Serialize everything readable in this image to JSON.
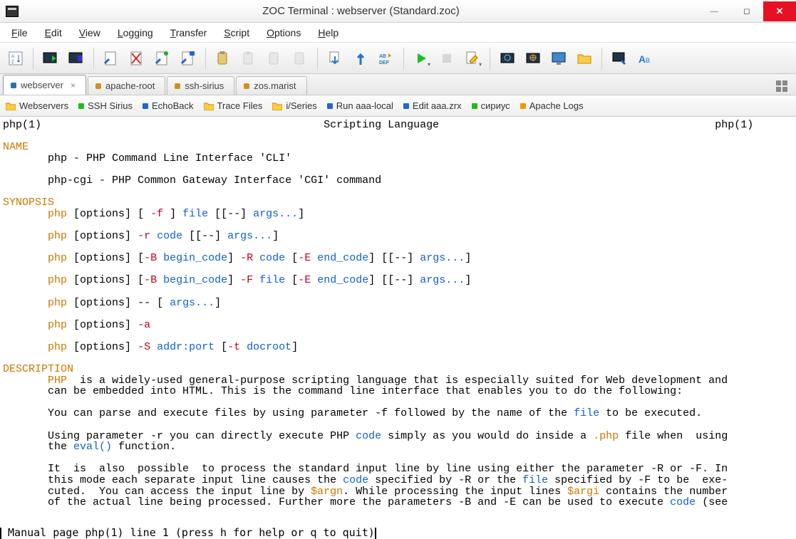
{
  "window": {
    "title": "ZOC Terminal : webserver (Standard.zoc)"
  },
  "menu": {
    "file": "File",
    "edit": "Edit",
    "view": "View",
    "logging": "Logging",
    "transfer": "Transfer",
    "script": "Script",
    "options": "Options",
    "help": "Help"
  },
  "toolbar_icons": [
    "hostdir",
    "quick1",
    "quick2",
    "send1",
    "send-del",
    "send2",
    "send3",
    "clip-copy",
    "clip-paste",
    "clip-gray1",
    "clip-gray2",
    "download",
    "upload",
    "abc-def",
    "play",
    "stop",
    "edit-script",
    "screen1",
    "screen2",
    "monitor",
    "folder",
    "screen-tool",
    "font"
  ],
  "tabs": [
    {
      "label": "webserver",
      "color": "#2a6db0",
      "active": true,
      "closable": true
    },
    {
      "label": "apache-root",
      "color": "#d09020",
      "active": false,
      "closable": false
    },
    {
      "label": "ssh-sirius",
      "color": "#d09020",
      "active": false,
      "closable": false
    },
    {
      "label": "zos.marist",
      "color": "#d09020",
      "active": false,
      "closable": false
    }
  ],
  "bookmarks": [
    {
      "label": "Webservers",
      "type": "folder"
    },
    {
      "label": "SSH Sirius",
      "type": "green"
    },
    {
      "label": "EchoBack",
      "type": "blue"
    },
    {
      "label": "Trace Files",
      "type": "folder"
    },
    {
      "label": "i/Series",
      "type": "folder"
    },
    {
      "label": "Run aaa-local",
      "type": "blue"
    },
    {
      "label": "Edit aaa.zrx",
      "type": "blue"
    },
    {
      "label": "сириус",
      "type": "green"
    },
    {
      "label": "Apache Logs",
      "type": "orange"
    }
  ],
  "man": {
    "header_left": "php(1)",
    "header_center": "Scripting Language",
    "header_right": "php(1)",
    "sec_name": "NAME",
    "name_l1": "php - PHP Command Line Interface 'CLI'",
    "name_l2": "php-cgi - PHP Common Gateway Interface 'CGI' command",
    "sec_syn": "SYNOPSIS",
    "syn": {
      "php": "php",
      "opts": "[options]",
      "f": "-f",
      "file": "file",
      "dd": "[--]",
      "args": "args...",
      "r": "-r",
      "code": "code",
      "B": "-B",
      "begin": "begin_code",
      "R": "-R",
      "E": "-E",
      "end": "end_code",
      "F": "-F",
      "dash": "--",
      "a": "-a",
      "S": "-S",
      "addr": "addr:port",
      "t": "-t",
      "docroot": "docroot",
      "lb": "[",
      "rb": "]",
      "lp": "[",
      "rp": "]"
    },
    "sec_desc": "DESCRIPTION",
    "desc": {
      "php": "PHP",
      "p1a": "  is a widely-used general-purpose scripting language that is especially suited for Web development and",
      "p1b": "can be embedded into HTML. This is the command line interface that enables you to do the following:",
      "p2a": "You can parse and execute files by using parameter -f followed by the name of the ",
      "file": "file",
      "p2b": " to be executed.",
      "p3a": "Using parameter -r you can directly execute PHP ",
      "code": "code",
      "p3b": " simply as you would do inside a ",
      "php_ext": ".php",
      "p3c": " file when  using",
      "p3d": "the ",
      "eval": "eval()",
      "p3e": " function.",
      "p4a": "It  is  also  possible  to process the standard input line by line using either the parameter -R or -F. In",
      "p4b": "this mode each separate input line causes the ",
      "code2": "code",
      "p4c": " specified by -R or the ",
      "file2": "file",
      "p4d": " specified by -F to be  exe‐",
      "p4e": "cuted.  You can access the input line by ",
      "argn": "$argn",
      "p4f": ". While processing the input lines ",
      "argi": "$argi",
      "p4g": " contains the number",
      "p4h": "of the actual line being processed. Further more the parameters -B and -E can be used to execute ",
      "code3": "code",
      "p4i": " (see"
    },
    "status_pre": " Manual page php(1) line 1 (press h for help or q to quit)"
  }
}
